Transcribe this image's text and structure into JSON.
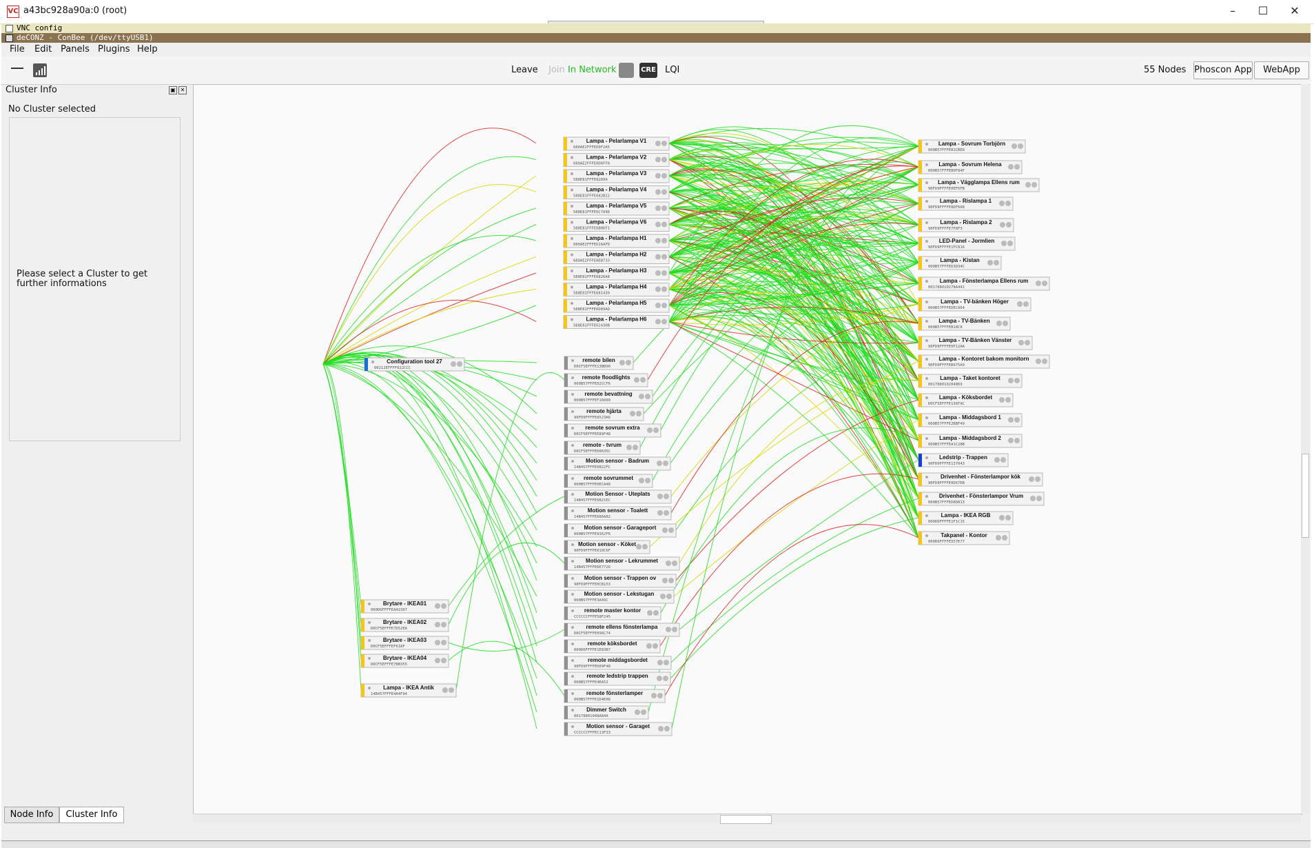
{
  "window": {
    "title": "a43bc928a90a:0 (root)",
    "logo_text": "VC"
  },
  "vnc_config": {
    "label": "VNC config"
  },
  "app_title": {
    "label": "deCONZ - ConBee (/dev/ttyUSB1)"
  },
  "menu": {
    "file": "File",
    "edit": "Edit",
    "panels": "Panels",
    "plugins": "Plugins",
    "help": "Help"
  },
  "toolbar": {
    "leave": "Leave",
    "join": "Join",
    "in_network": "In Network",
    "cre": "CRE",
    "lqi": "LQI",
    "node_count": "55 Nodes",
    "phoscon_app": "Phoscon App",
    "webapp": "WebApp"
  },
  "cluster_panel": {
    "title": "Cluster Info",
    "no_cluster": "No Cluster selected",
    "hint": "Please select a Cluster to get further informations"
  },
  "bottom_tabs": {
    "node_info": "Node Info",
    "cluster_info": "Cluster Info"
  },
  "colors": {
    "link_good": "#22dd22",
    "link_mid": "#d6d600",
    "link_bad": "#dd2222",
    "light_accent": "#f5c518",
    "coordinator_accent": "#1a6fd6",
    "sensor_accent": "#909090"
  },
  "nodes": {
    "coordinator": {
      "name": "Configuration tool 27",
      "mac": "00212EFFFF022CCC"
    },
    "center_lights": [
      {
        "name": "Lampa - Pelarlampa V1",
        "mac": "680AE2FFFED0F2A5"
      },
      {
        "name": "Lampa - Pelarlampa V2",
        "mac": "680AE2FFFE0D6FF0"
      },
      {
        "name": "Lampa - Pelarlampa V3",
        "mac": "588E81FFFE82D0A"
      },
      {
        "name": "Lampa - Pelarlampa V4",
        "mac": "588E81FFFE682B22"
      },
      {
        "name": "Lampa - Pelarlampa V5",
        "mac": "588E81FFFE6C7A9D"
      },
      {
        "name": "Lampa - Pelarlampa V6",
        "mac": "588E81FFFE6B0DF1"
      },
      {
        "name": "Lampa - Pelarlampa H1",
        "mac": "680AE2FFFED16AFD"
      },
      {
        "name": "Lampa - Pelarlampa H2",
        "mac": "680AE2FFFE0EB733"
      },
      {
        "name": "Lampa - Pelarlampa H3",
        "mac": "588E81FFFE6826A8"
      },
      {
        "name": "Lampa - Pelarlampa H4",
        "mac": "588E81FFFE681430"
      },
      {
        "name": "Lampa - Pelarlampa H5",
        "mac": "588E81FFFE6D89AD"
      },
      {
        "name": "Lampa - Pelarlampa H6",
        "mac": "588E81FFFE62430B"
      }
    ],
    "remotes": [
      {
        "name": "remote bilen",
        "mac": "D0CF5EFFFE13BB90",
        "accent": "#909090"
      },
      {
        "name": "remote floodlights",
        "mac": "000B57FFFE02CCF6",
        "accent": "#909090"
      },
      {
        "name": "remote bevattning",
        "mac": "000B57FFFEF16009",
        "accent": "#909090"
      },
      {
        "name": "remote hjärta",
        "mac": "90FD9FFFFE8523A6",
        "accent": "#909090"
      },
      {
        "name": "remote sovrum extra",
        "mac": "D0CF5EFFFEE89F48",
        "accent": "#909090"
      },
      {
        "name": "remote - tvrum",
        "mac": "D0CF5EFFFED0635C",
        "accent": "#909090"
      },
      {
        "name": "Motion sensor - Badrum",
        "mac": "14B457FFFE6B22FC",
        "accent": "#909090"
      },
      {
        "name": "remote sovrummet",
        "mac": "000B57FFFE0ECA48",
        "accent": "#909090"
      },
      {
        "name": "Motion Sensor - Uteplats",
        "mac": "14B457FFFE6B21EC",
        "accent": "#909090"
      },
      {
        "name": "Motion sensor - Toalett",
        "mac": "14B457FFFE686A82",
        "accent": "#909090"
      },
      {
        "name": "Motion sensor - Garageport",
        "mac": "000B57FFFE9362F6",
        "accent": "#909090"
      },
      {
        "name": "Motion sensor - Köket",
        "mac": "90FD9FFFFE010C6F",
        "accent": "#909090"
      },
      {
        "name": "Motion sensor - Lekrummet",
        "mac": "14B457FFFE6E7726",
        "accent": "#909090"
      },
      {
        "name": "Motion sensor - Trappen ov",
        "mac": "90FD9FFFFE0CB153",
        "accent": "#909090"
      },
      {
        "name": "Motion sensor - Lekstugan",
        "mac": "000B57FFFE3A49C",
        "accent": "#909090"
      },
      {
        "name": "remote master kontor",
        "mac": "CCCCCCFFFE58F245",
        "accent": "#909090"
      },
      {
        "name": "remote ellens fönsterlampa",
        "mac": "D0CF5EFFFE096C74",
        "accent": "#909090"
      },
      {
        "name": "remote köksbordet",
        "mac": "000D6FFFFE1E83B7",
        "accent": "#909090"
      },
      {
        "name": "remote middagsbordet",
        "mac": "90FD9FFFFED09F48",
        "accent": "#909090"
      },
      {
        "name": "remote ledstrip trappen",
        "mac": "000B57FFFE4EA52",
        "accent": "#909090"
      },
      {
        "name": "remote fönsterlamper",
        "mac": "000B57FFFE1D4EA6",
        "accent": "#909090"
      },
      {
        "name": "Dimmer Switch",
        "mac": "00178801048A84A",
        "accent": "#909090"
      },
      {
        "name": "Motion sensor - Garaget",
        "mac": "CCCCCCFFFEC13F33",
        "accent": "#909090"
      }
    ],
    "right_lights": [
      {
        "name": "Lampa - Sovrum Torbjörn",
        "mac": "000B57FFFEB1CBE8"
      },
      {
        "name": "Lampa - Sovrum Helena",
        "mac": "000B57FFFEB0F84F"
      },
      {
        "name": "Lampa - Vägglampa Ellens rum",
        "mac": "90FD9FFFFE0EF6FB"
      },
      {
        "name": "Lampa - Rislampa 1",
        "mac": "90FD9FFFFE8DF608"
      },
      {
        "name": "Lampa - Rislampa 2",
        "mac": "90FD9FFFFE7F8F3"
      },
      {
        "name": "LED-Panel - Jormlien",
        "mac": "90FD9FFFFE1FC816"
      },
      {
        "name": "Lampa - Kistan",
        "mac": "000B57FFFED3D34C"
      },
      {
        "name": "Lampa - Fönsterlampa Ellens rum",
        "mac": "001788010278A441"
      },
      {
        "name": "Lampa - TV-bänken Höger",
        "mac": "000B57FFFEDECA64"
      },
      {
        "name": "Lampa - TV-Bänken",
        "mac": "000B57FFFEB18C8"
      },
      {
        "name": "Lampa - TV-Bänken Vänster",
        "mac": "90FD9FFFFE0F12AA"
      },
      {
        "name": "Lampa - Kontoret bakom monitorn",
        "mac": "90FD9FFFFEB975A9"
      },
      {
        "name": "Lampa - Taket kontoret",
        "mac": "001788010204869"
      },
      {
        "name": "Lampa - Köksbordet",
        "mac": "D0CF5EFFFE136FAC"
      },
      {
        "name": "Lampa - Middagsbord 1",
        "mac": "000B57FFFE2BBF49"
      },
      {
        "name": "Lampa - Middagsbord 2",
        "mac": "000B57FFFEA1C28B"
      },
      {
        "name": "Ledstrip - Trappen",
        "mac": "90FD9FFFFE137043",
        "accent": "#1a3fd6"
      },
      {
        "name": "Drivenhet - Fönsterlampor kök",
        "mac": "90FD9FFFFE0D67EB"
      },
      {
        "name": "Drivenhet - Fönsterlampor Vrum",
        "mac": "000B57FFFED8D813"
      },
      {
        "name": "Lampa - IKEA RGB",
        "mac": "000D6FFFFE1F1C15"
      },
      {
        "name": "Takpanel - Kontor",
        "mac": "000D6FFFFE557E77"
      }
    ],
    "left_group": [
      {
        "name": "Brytare - IKEA01",
        "mac": "000D6FFFFEA42307"
      },
      {
        "name": "Brytare - IKEA02",
        "mac": "D0CF5EFFFE7D52EA"
      },
      {
        "name": "Brytare - IKEA03",
        "mac": "D0CF5EFFFEF618F"
      },
      {
        "name": "Brytare - IKEA04",
        "mac": "D0CF5EFFFE7BB355"
      },
      {
        "name": "Lampa - IKEA Antik",
        "mac": "14B457FFFE4A4F94"
      }
    ]
  }
}
